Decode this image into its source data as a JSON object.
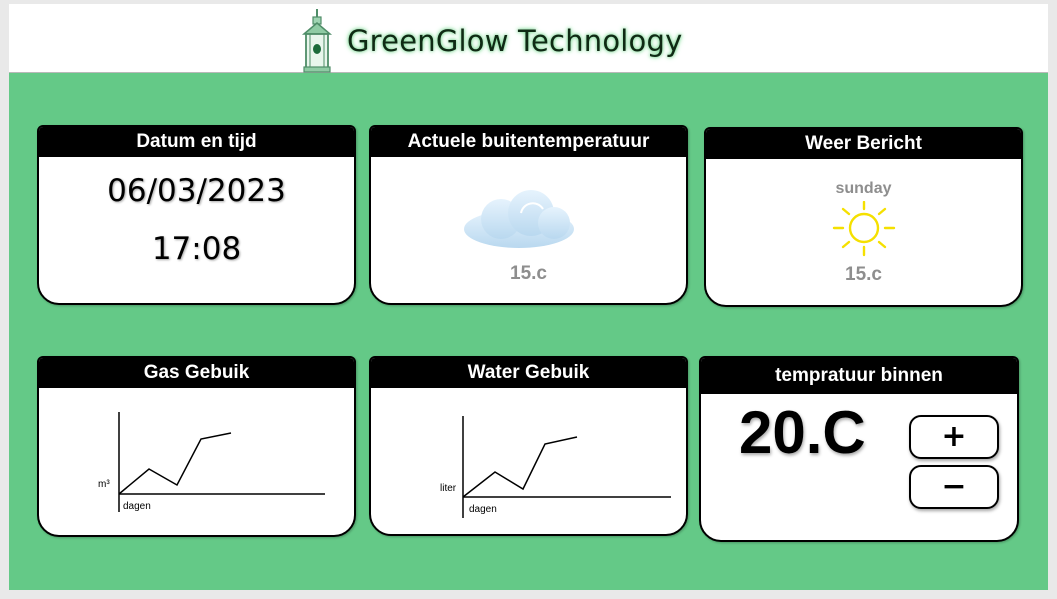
{
  "app": {
    "title": "GreenGlow Technology"
  },
  "cards": {
    "datetime": {
      "title": "Datum en tijd",
      "date": "06/03/2023",
      "time": "17:08"
    },
    "outside_temp": {
      "title": "Actuele buitentemperatuur",
      "icon": "cloud-icon",
      "value": "15.c"
    },
    "weather": {
      "title": "Weer Bericht",
      "icon": "sun-icon",
      "day": "sunday",
      "value": "15.c"
    },
    "gas": {
      "title": "Gas Gebuik",
      "ylabel": "m³",
      "xlabel": "dagen"
    },
    "water": {
      "title": "Water Gebuik",
      "ylabel": "liter",
      "xlabel": "dagen"
    },
    "inside_temp": {
      "title": "tempratuur binnen",
      "value": "20.C",
      "plus_label": "+",
      "minus_label": "−"
    }
  },
  "colors": {
    "background": "#64c987",
    "card": "#ffffff",
    "title_bar": "#000000",
    "muted_text": "#8e8e8e",
    "sun": "#f5e000",
    "cloud": "#cfe6f7"
  }
}
